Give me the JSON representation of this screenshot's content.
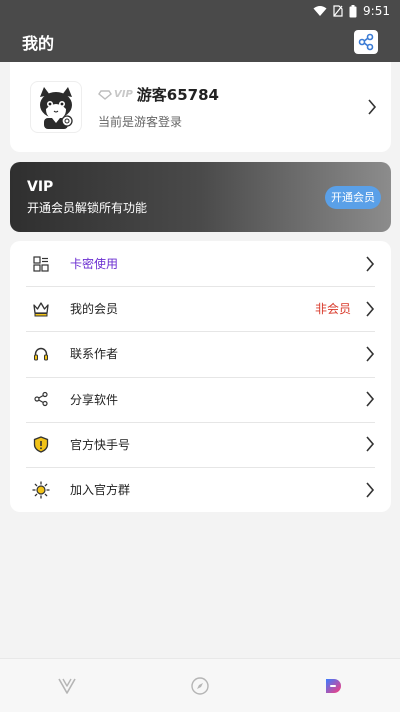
{
  "status_bar": {
    "time": "9:51"
  },
  "header": {
    "title": "我的"
  },
  "profile": {
    "vip_tag": "VIP",
    "username": "游客65784",
    "login_hint": "当前是游客登录"
  },
  "vip_banner": {
    "title": "VIP",
    "desc": "开通会员解锁所有功能",
    "button": "开通会员"
  },
  "menu": [
    {
      "label": "卡密使用",
      "icon": "card-key-icon",
      "value": ""
    },
    {
      "label": "我的会员",
      "icon": "crown-icon",
      "value": "非会员"
    },
    {
      "label": "联系作者",
      "icon": "headset-icon",
      "value": ""
    },
    {
      "label": "分享软件",
      "icon": "share-icon",
      "value": ""
    },
    {
      "label": "官方快手号",
      "icon": "shield-icon",
      "value": ""
    },
    {
      "label": "加入官方群",
      "icon": "sun-gear-icon",
      "value": ""
    }
  ],
  "colors": {
    "accent": "#6b2ed1",
    "status_red": "#d93a2b",
    "button_blue": "#5aa0e8",
    "header_bg": "#4a4a4a"
  },
  "bottom_nav": [
    {
      "icon": "v-logo-icon"
    },
    {
      "icon": "compass-icon"
    },
    {
      "icon": "profile-tab-icon"
    }
  ]
}
